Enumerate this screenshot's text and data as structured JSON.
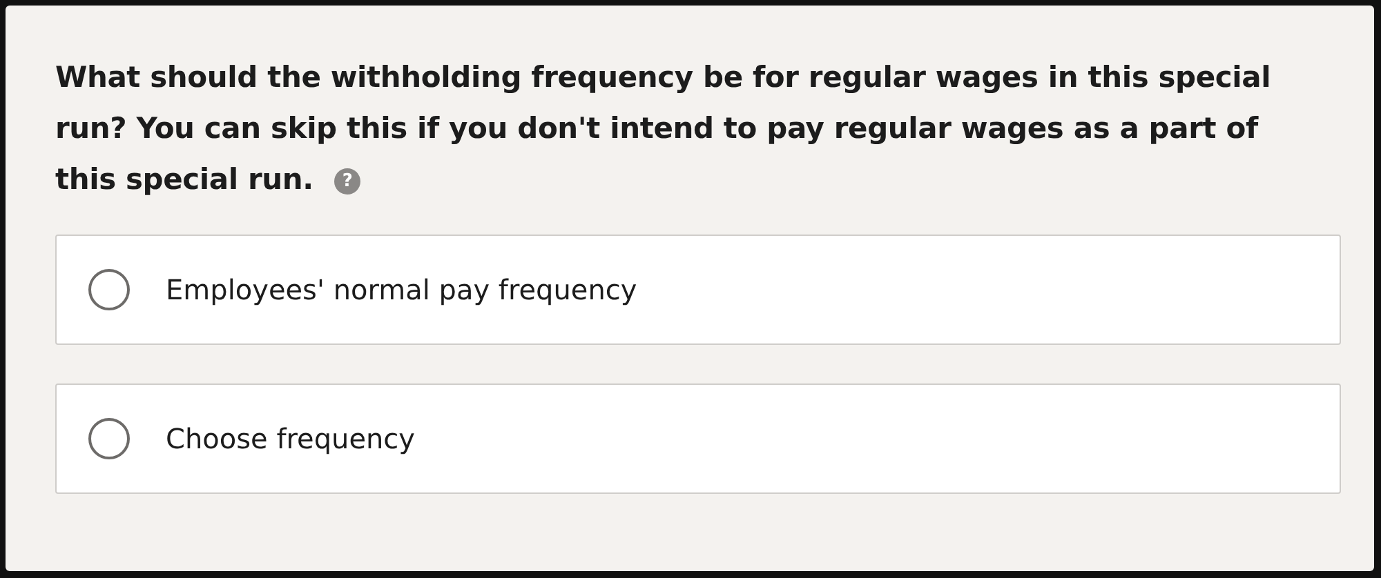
{
  "question": {
    "text": "What should the withholding frequency be for regular wages in this special run? You can skip this if you don't intend to pay regular wages as a part of this special run.",
    "help": "?"
  },
  "options": [
    {
      "label": "Employees' normal pay frequency",
      "selected": false
    },
    {
      "label": "Choose frequency",
      "selected": false
    }
  ]
}
